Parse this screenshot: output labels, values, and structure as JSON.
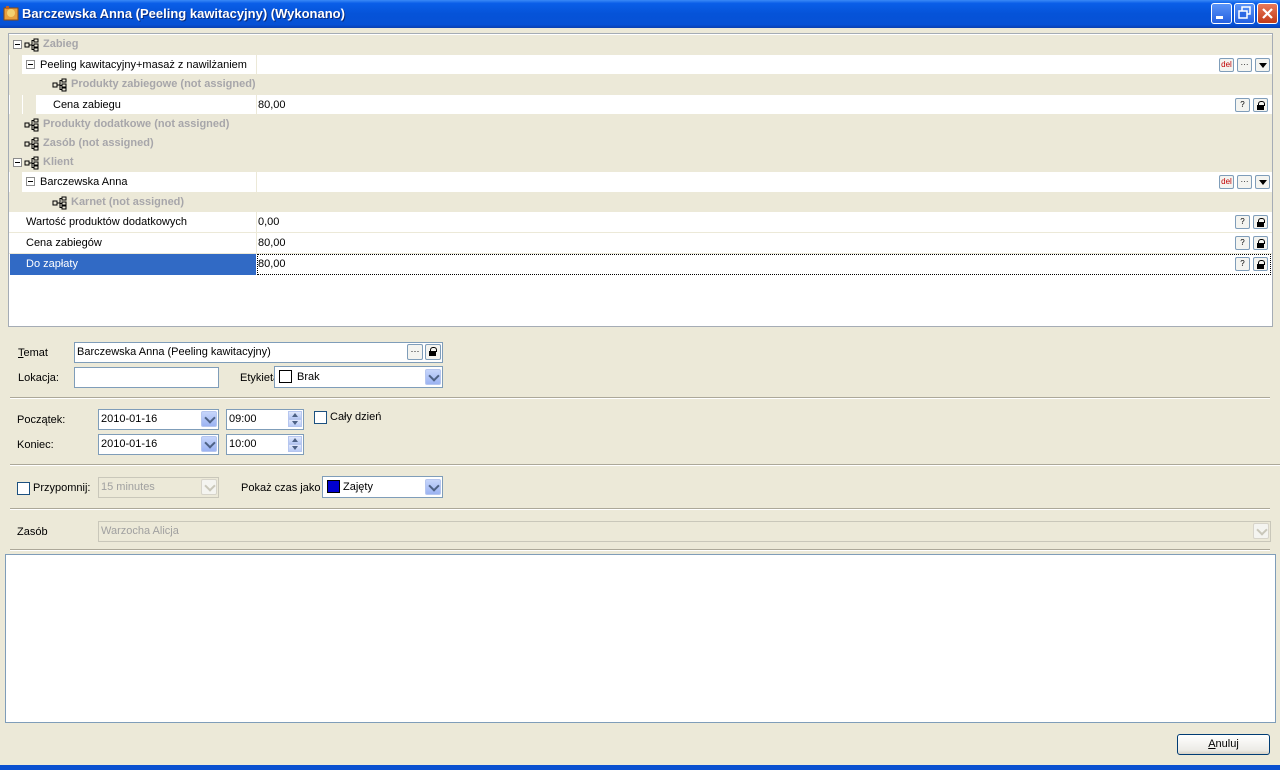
{
  "window": {
    "title": "Barczewska Anna (Peeling kawitacyjny) (Wykonano)"
  },
  "grid": {
    "zabieg_cat": "Zabieg",
    "zabieg_item": "Peeling kawitacyjny+masaż z nawilżaniem",
    "produkty_zabiegowe": "Produkty zabiegowe (not assigned)",
    "cena_zabiegu_label": "Cena zabiegu",
    "cena_zabiegu_value": "80,00",
    "produkty_dodatkowe": "Produkty dodatkowe (not assigned)",
    "zasob_cat": "Zasób (not assigned)",
    "klient_cat": "Klient",
    "klient_item": "Barczewska Anna",
    "karnet": "Karnet (not assigned)",
    "wartosc_label": "Wartość produktów dodatkowych",
    "wartosc_value": "0,00",
    "cena_zabiegow_label": "Cena zabiegów",
    "cena_zabiegow_value": "80,00",
    "do_zaplaty_label": "Do zapłaty",
    "do_zaplaty_value": "80,00",
    "del_label": "del",
    "dots_label": "···",
    "help_label": "?"
  },
  "form": {
    "temat_label": "Temat",
    "temat_value": "Barczewska Anna (Peeling kawitacyjny)",
    "lokacja_label": "Lokacja:",
    "lokacja_value": "",
    "etykieta_label": "Etykieta:",
    "etykieta_value": "Brak",
    "poczatek_label": "Początek:",
    "poczatek_date": "2010-01-16",
    "poczatek_time": "09:00",
    "caly_dzien_label": "Cały dzień",
    "koniec_label": "Koniec:",
    "koniec_date": "2010-01-16",
    "koniec_time": "10:00",
    "przypomnij_label": "Przypomnij:",
    "przypomnij_value": "15 minutes",
    "pokaz_label": "Pokaż czas jako",
    "pokaz_value": "Zajęty",
    "pokaz_color": "#0000d0",
    "etykieta_color": "#ffffff",
    "zasob_label": "Zasób",
    "zasob_value": "Warzocha Alicja",
    "anuluj_label": "Anuluj"
  }
}
